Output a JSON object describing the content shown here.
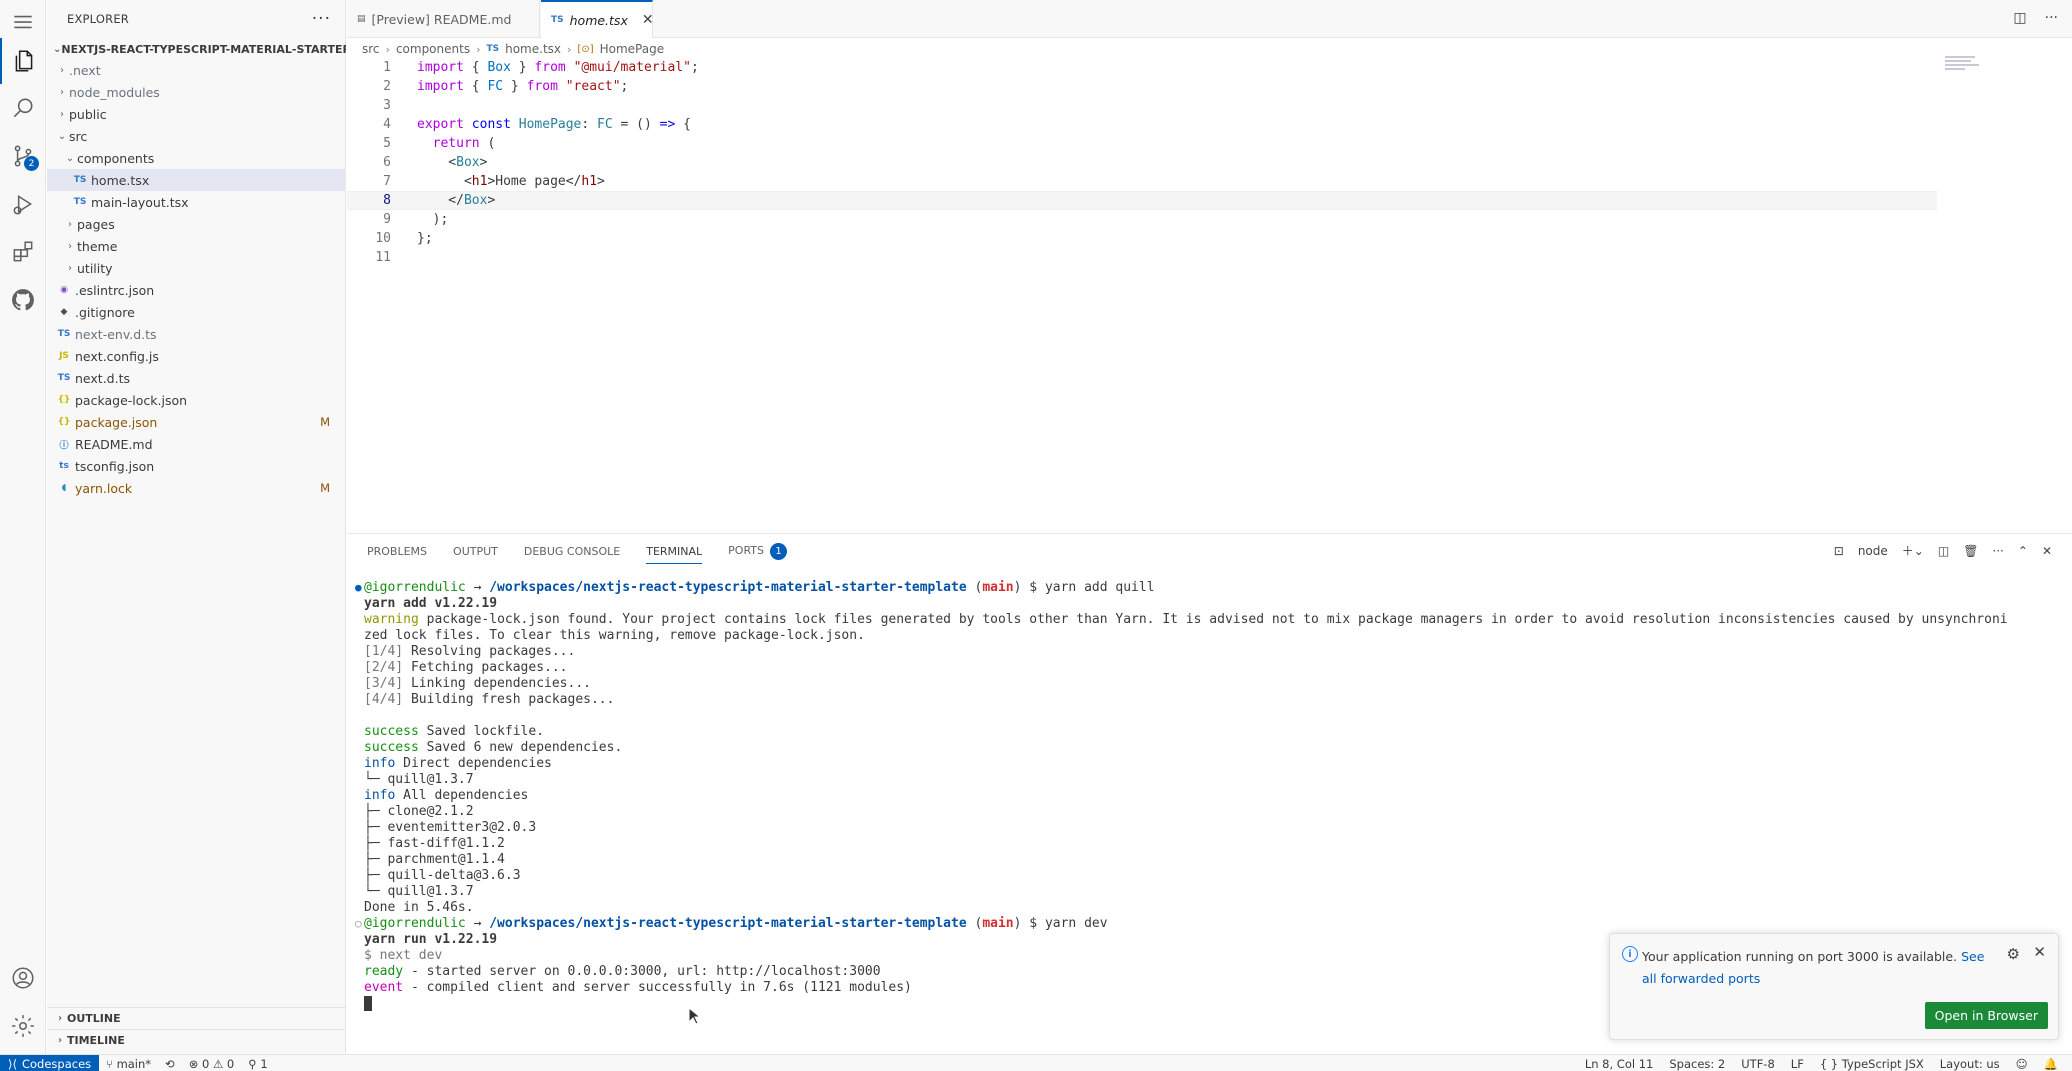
{
  "activity_bar": {
    "icons": [
      "explorer-icon",
      "search-icon",
      "source-control-icon",
      "run-debug-icon",
      "extensions-icon",
      "github-icon"
    ],
    "source_control_badge": "2",
    "bottom_icons": [
      "account-icon",
      "settings-icon"
    ]
  },
  "explorer": {
    "title": "EXPLORER",
    "root": "NEXTJS-REACT-TYPESCRIPT-MATERIAL-STARTER-...",
    "items": [
      {
        "label": ".next",
        "type": "folder",
        "depth": 1,
        "open": false,
        "dim": true
      },
      {
        "label": "node_modules",
        "type": "folder",
        "depth": 1,
        "open": false,
        "dim": true
      },
      {
        "label": "public",
        "type": "folder",
        "depth": 1,
        "open": false
      },
      {
        "label": "src",
        "type": "folder",
        "depth": 1,
        "open": true
      },
      {
        "label": "components",
        "type": "folder",
        "depth": 2,
        "open": true
      },
      {
        "label": "home.tsx",
        "type": "ts",
        "badge": "TS",
        "depth": 3,
        "selected": true
      },
      {
        "label": "main-layout.tsx",
        "type": "ts",
        "badge": "TS",
        "depth": 3
      },
      {
        "label": "pages",
        "type": "folder",
        "depth": 2,
        "open": false
      },
      {
        "label": "theme",
        "type": "folder",
        "depth": 2,
        "open": false
      },
      {
        "label": "utility",
        "type": "folder",
        "depth": 2,
        "open": false
      },
      {
        "label": ".eslintrc.json",
        "type": "eslint",
        "badge": "◉",
        "depth": 1
      },
      {
        "label": ".gitignore",
        "type": "git",
        "badge": "◆",
        "depth": 1
      },
      {
        "label": "next-env.d.ts",
        "type": "ts",
        "badge": "TS",
        "depth": 1,
        "dim": true
      },
      {
        "label": "next.config.js",
        "type": "js",
        "badge": "JS",
        "depth": 1
      },
      {
        "label": "next.d.ts",
        "type": "ts",
        "badge": "TS",
        "depth": 1
      },
      {
        "label": "package-lock.json",
        "type": "json",
        "badge": "{}",
        "depth": 1
      },
      {
        "label": "package.json",
        "type": "json",
        "badge": "{}",
        "depth": 1,
        "modified": "M"
      },
      {
        "label": "README.md",
        "type": "info",
        "badge": "ⓘ",
        "depth": 1
      },
      {
        "label": "tsconfig.json",
        "type": "ts",
        "badge": "ts",
        "depth": 1
      },
      {
        "label": "yarn.lock",
        "type": "yarn",
        "badge": "◖",
        "depth": 1,
        "modified": "M"
      }
    ],
    "outline": "OUTLINE",
    "timeline": "TIMELINE",
    "more": "···"
  },
  "tabs": [
    {
      "label": "[Preview] README.md",
      "icon": "▤",
      "active": false
    },
    {
      "label": "home.tsx",
      "icon": "TS",
      "active": true,
      "close": "✕"
    }
  ],
  "breadcrumb": [
    "src",
    "components",
    "home.tsx",
    "HomePage"
  ],
  "breadcrumb_icons": {
    "file": "TS",
    "symbol": "[⊙]"
  },
  "editor": {
    "line_numbers": [
      "1",
      "2",
      "3",
      "4",
      "5",
      "6",
      "7",
      "8",
      "9",
      "10",
      "11"
    ],
    "current_line": 8
  },
  "panel": {
    "tabs": [
      "PROBLEMS",
      "OUTPUT",
      "DEBUG CONSOLE",
      "TERMINAL",
      "PORTS"
    ],
    "active_tab": "TERMINAL",
    "ports_badge": "1",
    "terminal_name": "node"
  },
  "terminal": {
    "user": "@igorrendulic",
    "arrow": "→",
    "path": "/workspaces/nextjs-react-typescript-material-starter-template",
    "branch": "main",
    "cmd1": "yarn add quill",
    "yarn_add": "yarn add v1.22.19",
    "warning_label": "warning",
    "warning_text": " package-lock.json found. Your project contains lock files generated by tools other than Yarn. It is advised not to mix package managers in order to avoid resolution inconsistencies caused by unsynchroni",
    "warning_text2": "zed lock files. To clear this warning, remove package-lock.json.",
    "steps": [
      {
        "step": "[1/4]",
        "text": " Resolving packages..."
      },
      {
        "step": "[2/4]",
        "text": " Fetching packages..."
      },
      {
        "step": "[3/4]",
        "text": " Linking dependencies..."
      },
      {
        "step": "[4/4]",
        "text": " Building fresh packages..."
      }
    ],
    "success_label": "success",
    "success1": " Saved lockfile.",
    "success2": " Saved 6 new dependencies.",
    "info_label": "info",
    "info1": " Direct dependencies",
    "direct": [
      "└─ quill@1.3.7"
    ],
    "info2": " All dependencies",
    "all": [
      "├─ clone@2.1.2",
      "├─ eventemitter3@2.0.3",
      "├─ fast-diff@1.1.2",
      "├─ parchment@1.1.4",
      "├─ quill-delta@3.6.3",
      "└─ quill@1.3.7"
    ],
    "done": "Done in 5.46s.",
    "cmd2": "yarn dev",
    "yarn_run": "yarn run v1.22.19",
    "next_dev": "$ next dev",
    "ready_label": "ready",
    "ready_text": " - started server on 0.0.0.0:3000, url: http://localhost:3000",
    "event_label": "event",
    "event_text": " - compiled client and server successfully in 7.6s (1121 modules)"
  },
  "notification": {
    "text": "Your application running on port 3000 is available.",
    "link": "See all forwarded ports",
    "button": "Open in Browser"
  },
  "status_bar": {
    "remote": "Codespaces",
    "branch": "main*",
    "sync": "⟲",
    "problems": "⊗ 0 ⚠ 0",
    "ports": "1",
    "position": "Ln 8, Col 11",
    "spaces": "Spaces: 2",
    "encoding": "UTF-8",
    "eol": "LF",
    "language": "TypeScript JSX",
    "layout": "Layout: us"
  },
  "colors": {
    "accent": "#005fb8",
    "button_green": "#1a8a38",
    "modified": "#895503"
  }
}
